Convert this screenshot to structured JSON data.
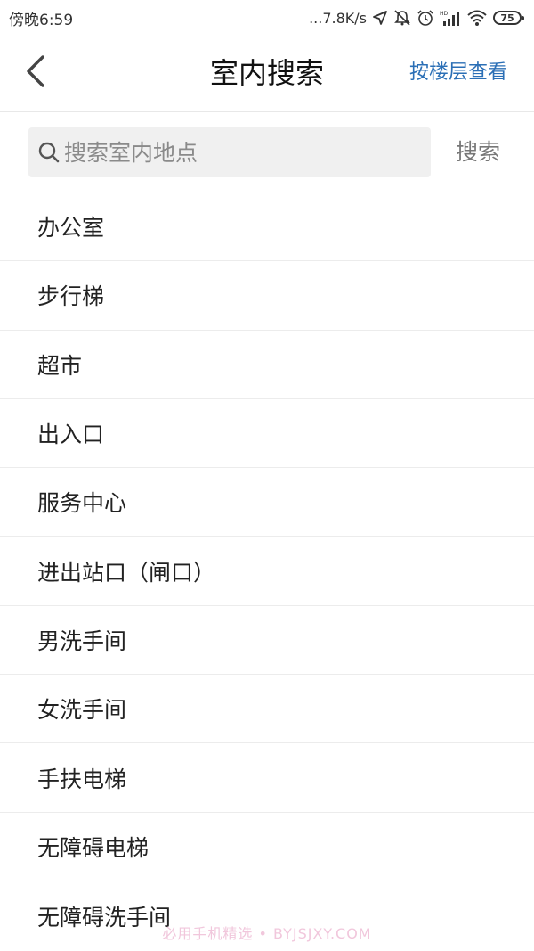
{
  "status_bar": {
    "time": "傍晚6:59",
    "network_speed": "...7.8K/s",
    "battery_level": "75",
    "icons": [
      "location-icon",
      "mute-icon",
      "alarm-icon",
      "hd-signal-icon",
      "wifi-icon",
      "battery-icon"
    ]
  },
  "header": {
    "title": "室内搜索",
    "floor_link": "按楼层查看",
    "back_icon": "chevron-left-icon"
  },
  "search": {
    "placeholder": "搜索室内地点",
    "value": "",
    "button_label": "搜索"
  },
  "categories": [
    "办公室",
    "步行梯",
    "超市",
    "出入口",
    "服务中心",
    "进出站口（闸口）",
    "男洗手间",
    "女洗手间",
    "手扶电梯",
    "无障碍电梯",
    "无障碍洗手间"
  ],
  "watermark": "必用手机精选 • BYJSJXY.COM",
  "colors": {
    "accent": "#2b6fb6",
    "search_bg": "#f0f0f0",
    "divider": "#ececec"
  }
}
